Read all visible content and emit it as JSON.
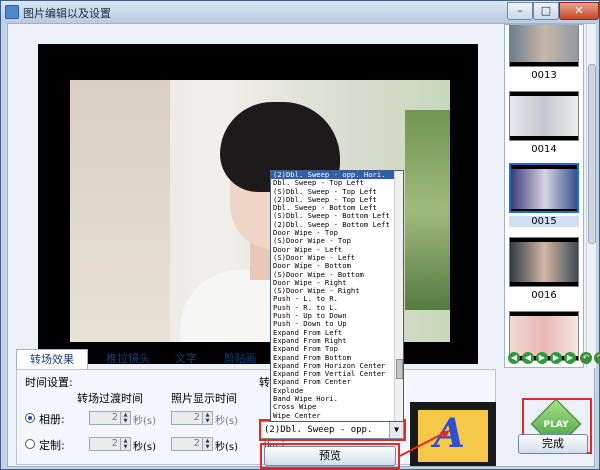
{
  "window": {
    "title": "图片编辑以及设置",
    "minimize_glyph": "–",
    "maximize_glyph": "□",
    "close_glyph": "✕"
  },
  "thumbnails": [
    {
      "number": "0013",
      "selected": false
    },
    {
      "number": "0014",
      "selected": false
    },
    {
      "number": "0015",
      "selected": true
    },
    {
      "number": "0016",
      "selected": false
    },
    {
      "number": "",
      "selected": false
    }
  ],
  "tabs": [
    "转场效果",
    "推拉镜头",
    "文字",
    "剪贴画"
  ],
  "settings": {
    "group_title": "时间设置:",
    "col_transition_time": "转场过渡时间",
    "col_display_time": "照片显示时间",
    "album_label": "相册:",
    "custom_label": "定制:",
    "album_transition_value": "2",
    "album_display_value": "2",
    "custom_transition_value": "2",
    "custom_display_value": "2",
    "unit_label": "秒(s)",
    "transition_label": "转"
  },
  "transition_combo": {
    "selected": "(2)Dbl. Sweep - opp. Hori."
  },
  "transition_list": [
    "(2)Dbl. Sweep - opp. Hori.",
    "Dbl. Sweep - Top Left",
    "(S)Dbl. Sweep - Top Left",
    "(2)Dbl. Sweep - Top Left",
    "Dbl. Sweep - Bottom Left",
    "(S)Dbl. Sweep - Bottom Left",
    "(2)Dbl. Sweep - Bottom Left",
    "Door Wipe - Top",
    "(S)Door Wipe - Top",
    "Door Wipe - Left",
    "(S)Door Wipe - Left",
    "Door Wipe - Bottom",
    "(S)Door Wipe - Bottom",
    "Door Wipe - Right",
    "(S)Door Wipe - Right",
    "Push - L. to R.",
    "Push - R. to L.",
    "Push - Up to Down",
    "Push - Down to Up",
    "Expand From Left",
    "Expand From Right",
    "Expand From Top",
    "Expand From Bottom",
    "Expand From Horizon Center",
    "Expand From Vertial Center",
    "Expand From Center",
    "Explode",
    "Band Wipe Hori.",
    "Cross Wipe",
    "Wipe Center"
  ],
  "buttons": {
    "preview": "预览",
    "done": "完成",
    "play": "PLAY"
  },
  "fx_preview_letter": "A",
  "transport_icons": [
    "first-icon",
    "prev-icon",
    "play-small-icon",
    "next-icon",
    "last-icon",
    "rotate-left-icon",
    "rotate-right-icon"
  ],
  "colors": {
    "highlight": "#e32a2a",
    "list_selection": "#2f5fb0",
    "play_green": "#3a9b36"
  }
}
